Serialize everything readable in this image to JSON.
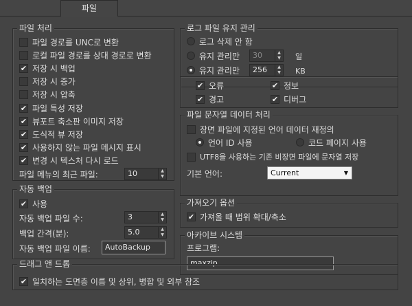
{
  "tab": {
    "label": "파일"
  },
  "file_handling": {
    "title": "파일 처리",
    "items": [
      {
        "label": "파일 경로를 UNC로 변환",
        "checked": false
      },
      {
        "label": "로컬 파일 경로를 상대 경로로 변환",
        "checked": false
      },
      {
        "label": "저장 시 백업",
        "checked": true
      },
      {
        "label": "저장 시 증가",
        "checked": false
      },
      {
        "label": "저장 시 압축",
        "checked": false
      },
      {
        "label": "파일 특성 저장",
        "checked": true
      },
      {
        "label": "뷰포트 축소판 이미지 저장",
        "checked": true
      },
      {
        "label": "도식적 뷰 저장",
        "checked": true
      },
      {
        "label": "사용하지 않는 파일 메시지 표시",
        "checked": true
      },
      {
        "label": "변경 시 텍스처 다시 로드",
        "checked": true
      }
    ],
    "recent_label": "파일 메뉴의 최근 파일:",
    "recent_value": "10"
  },
  "auto_backup": {
    "title": "자동 백업",
    "enable_label": "사용",
    "enable_checked": true,
    "count_label": "자동 백업 파일 수:",
    "count_value": "3",
    "interval_label": "백업 간격(분):",
    "interval_value": "5.0",
    "name_label": "자동 백업 파일 이름:",
    "name_value": "AutoBackup"
  },
  "log": {
    "title": "로그 파일 유지 관리",
    "radio_none": "로그 삭제 안 함",
    "radio_days": "유지 관리만",
    "days_value": "30",
    "days_unit": "일",
    "radio_kb": "유지 관리만",
    "kb_value": "256",
    "kb_unit": "KB",
    "selected": "kb",
    "checks": [
      {
        "label": "오류",
        "checked": true
      },
      {
        "label": "정보",
        "checked": true
      },
      {
        "label": "경고",
        "checked": true
      },
      {
        "label": "디버그",
        "checked": true
      }
    ]
  },
  "string_data": {
    "title": "파일 문자열 데이터 처리",
    "reinterpret_label": "장면 파일에 지정된 언어 데이터 재정의",
    "reinterpret_checked": false,
    "radio_lang_id": "언어 ID 사용",
    "radio_codepage": "코드 페이지 사용",
    "utf8_label": "UTF8을 사용하는 기존 비장면 파일에 문자열 저장",
    "utf8_checked": false,
    "default_lang_label": "기본 언어:",
    "default_lang_value": "Current"
  },
  "import": {
    "title": "가져오기 옵션",
    "zoom_label": "가져올 때 범위 확대/축소",
    "zoom_checked": true
  },
  "archive": {
    "title": "아카이브 시스템",
    "program_label": "프로그램:",
    "program_value": "maxzip"
  },
  "drag_drop": {
    "title": "드래그 앤 드롭",
    "match_label": "일치하는 도면층 이름 및 상위, 병합 및 외부 참조",
    "match_checked": true
  }
}
